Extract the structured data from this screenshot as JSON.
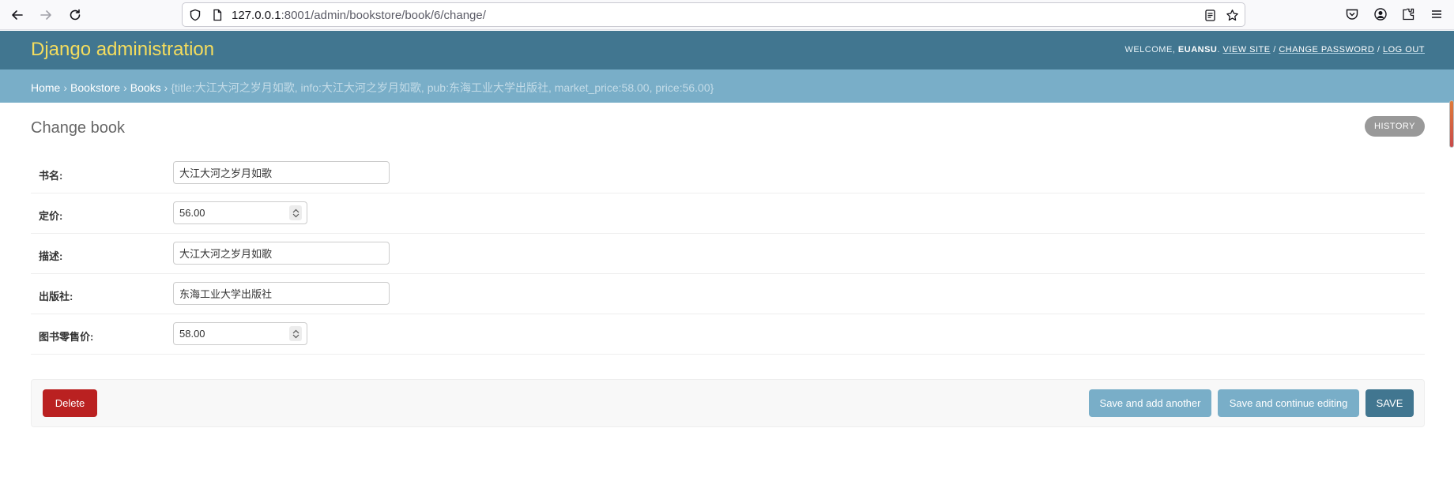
{
  "browser": {
    "url_host": "127.0.0.1",
    "url_rest": ":8001/admin/bookstore/book/6/change/"
  },
  "header": {
    "branding": "Django administration",
    "welcome": "WELCOME,",
    "username": "EUANSU",
    "view_site": "VIEW SITE",
    "change_password": "CHANGE PASSWORD",
    "log_out": "LOG OUT",
    "sep": "/"
  },
  "breadcrumbs": {
    "home": "Home",
    "app": "Bookstore",
    "model": "Books",
    "current": "{title:大江大河之岁月如歌, info:大江大河之岁月如歌, pub:东海工业大学出版社, market_price:58.00, price:56.00}",
    "sep": "›"
  },
  "page": {
    "title": "Change book",
    "history": "HISTORY"
  },
  "form": {
    "title": {
      "label": "书名:",
      "value": "大江大河之岁月如歌"
    },
    "price": {
      "label": "定价:",
      "value": "56.00"
    },
    "info": {
      "label": "描述:",
      "value": "大江大河之岁月如歌"
    },
    "pub": {
      "label": "出版社:",
      "value": "东海工业大学出版社"
    },
    "market_price": {
      "label": "图书零售价:",
      "value": "58.00"
    }
  },
  "submit": {
    "delete": "Delete",
    "save_add_another": "Save and add another",
    "save_continue": "Save and continue editing",
    "save": "SAVE"
  },
  "colors": {
    "header": "#417690",
    "breadcrumbs": "#79aec8",
    "branding": "#f5dd5d",
    "delete": "#ba2121"
  }
}
